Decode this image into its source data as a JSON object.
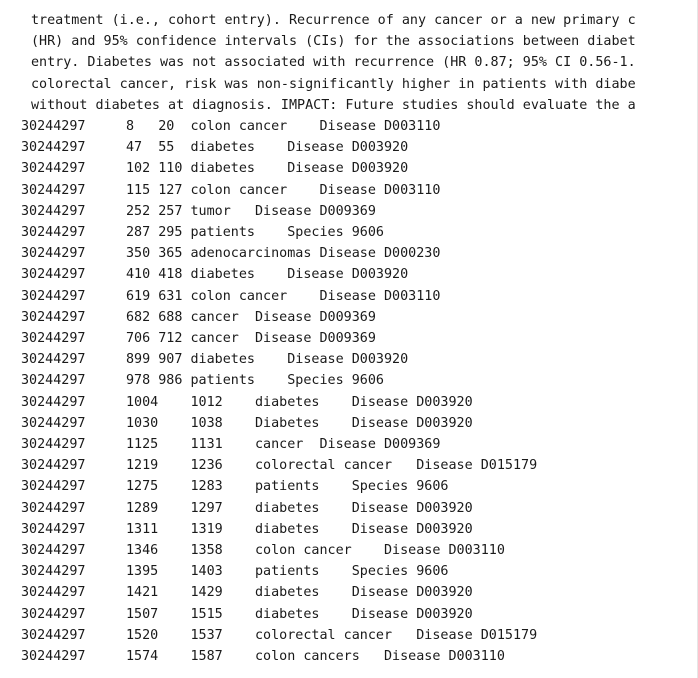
{
  "paragraph_lines": [
    "treatment (i.e., cohort entry). Recurrence of any cancer or a new primary c",
    "(HR) and 95% confidence intervals (CIs) for the associations between diabet",
    "entry. Diabetes was not associated with recurrence (HR 0.87; 95% CI 0.56-1.",
    "colorectal cancer, risk was non-significantly higher in patients with diabe",
    "without diabetes at diagnosis. IMPACT: Future studies should evaluate the a"
  ],
  "annotation_rows": [
    {
      "pmid": "30244297",
      "rest": "8   20  colon cancer    Disease D003110"
    },
    {
      "pmid": "30244297",
      "rest": "47  55  diabetes    Disease D003920"
    },
    {
      "pmid": "30244297",
      "rest": "102 110 diabetes    Disease D003920"
    },
    {
      "pmid": "30244297",
      "rest": "115 127 colon cancer    Disease D003110"
    },
    {
      "pmid": "30244297",
      "rest": "252 257 tumor   Disease D009369"
    },
    {
      "pmid": "30244297",
      "rest": "287 295 patients    Species 9606"
    },
    {
      "pmid": "30244297",
      "rest": "350 365 adenocarcinomas Disease D000230"
    },
    {
      "pmid": "30244297",
      "rest": "410 418 diabetes    Disease D003920"
    },
    {
      "pmid": "30244297",
      "rest": "619 631 colon cancer    Disease D003110"
    },
    {
      "pmid": "30244297",
      "rest": "682 688 cancer  Disease D009369"
    },
    {
      "pmid": "30244297",
      "rest": "706 712 cancer  Disease D009369"
    },
    {
      "pmid": "30244297",
      "rest": "899 907 diabetes    Disease D003920"
    },
    {
      "pmid": "30244297",
      "rest": "978 986 patients    Species 9606"
    },
    {
      "pmid": "30244297",
      "rest": "1004    1012    diabetes    Disease D003920"
    },
    {
      "pmid": "30244297",
      "rest": "1030    1038    Diabetes    Disease D003920"
    },
    {
      "pmid": "30244297",
      "rest": "1125    1131    cancer  Disease D009369"
    },
    {
      "pmid": "30244297",
      "rest": "1219    1236    colorectal cancer   Disease D015179"
    },
    {
      "pmid": "30244297",
      "rest": "1275    1283    patients    Species 9606"
    },
    {
      "pmid": "30244297",
      "rest": "1289    1297    diabetes    Disease D003920"
    },
    {
      "pmid": "30244297",
      "rest": "1311    1319    diabetes    Disease D003920"
    },
    {
      "pmid": "30244297",
      "rest": "1346    1358    colon cancer    Disease D003110"
    },
    {
      "pmid": "30244297",
      "rest": "1395    1403    patients    Species 9606"
    },
    {
      "pmid": "30244297",
      "rest": "1421    1429    diabetes    Disease D003920"
    },
    {
      "pmid": "30244297",
      "rest": "1507    1515    diabetes    Disease D003920"
    },
    {
      "pmid": "30244297",
      "rest": "1520    1537    colorectal cancer   Disease D015179"
    },
    {
      "pmid": "30244297",
      "rest": "1574    1587    colon cancers   Disease D003110"
    }
  ]
}
